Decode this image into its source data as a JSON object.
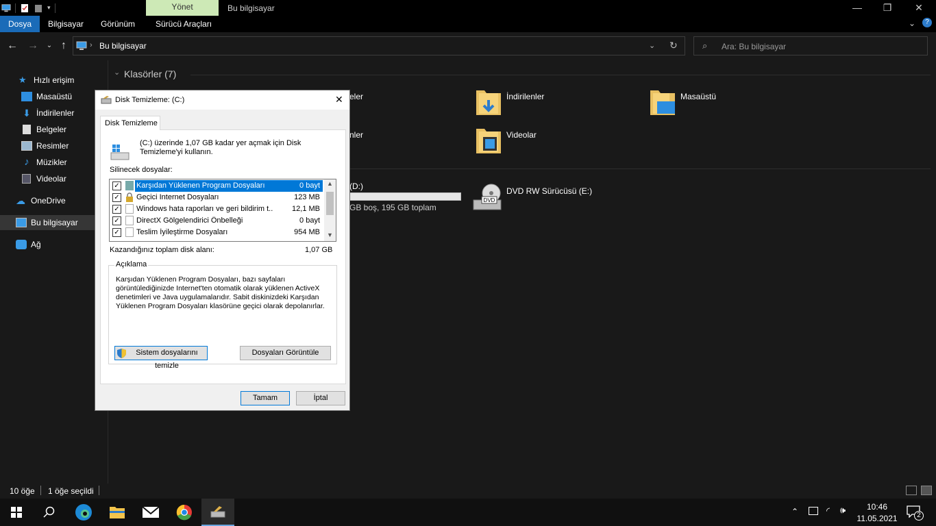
{
  "window": {
    "manage_tab": "Yönet",
    "title": "Bu bilgisayar",
    "minimize": "—",
    "restore": "❐",
    "close": "✕"
  },
  "ribbon": {
    "tabs": [
      "Dosya",
      "Bilgisayar",
      "Görünüm",
      "Sürücü Araçları"
    ]
  },
  "address": {
    "path": "Bu bilgisayar",
    "search_placeholder": "Ara: Bu bilgisayar"
  },
  "sidebar": {
    "items": [
      {
        "label": "Hızlı erişim"
      },
      {
        "label": "Masaüstü"
      },
      {
        "label": "İndirilenler"
      },
      {
        "label": "Belgeler"
      },
      {
        "label": "Resimler"
      },
      {
        "label": "Müzikler"
      },
      {
        "label": "Videolar"
      },
      {
        "label": "OneDrive"
      },
      {
        "label": "Bu bilgisayar"
      },
      {
        "label": "Ağ"
      }
    ]
  },
  "main": {
    "folders_header": "Klasörler (7)",
    "folders": [
      {
        "label": "eler"
      },
      {
        "label": "İndirilenler"
      },
      {
        "label": "Masaüstü"
      },
      {
        "label": "nler"
      },
      {
        "label": "Videolar"
      }
    ],
    "drives": [
      {
        "label": "(D:)",
        "free": "GB boş, 195 GB toplam"
      },
      {
        "label": "DVD RW Sürücüsü (E:)",
        "icon_text": "DVD"
      }
    ]
  },
  "status": {
    "item_count": "10 öğe",
    "selected": "1 öğe seçildi"
  },
  "taskbar": {
    "time": "10:46",
    "date": "11.05.2021",
    "notifications": "2"
  },
  "dialog": {
    "title": "Disk Temizleme:  (C:)",
    "tab": "Disk Temizleme",
    "intro_line1": "(C:) üzerinde 1,07 GB kadar yer açmak için Disk",
    "intro_line2": "Temizleme'yi kullanın.",
    "files_label": "Silinecek dosyalar:",
    "files": [
      {
        "name": "Karşıdan Yüklenen Program Dosyaları",
        "size": "0 bayt",
        "checked": true,
        "selected": true
      },
      {
        "name": "Geçici Internet Dosyaları",
        "size": "123 MB",
        "checked": true,
        "selected": false
      },
      {
        "name": "Windows hata raporları ve geri bildirim t...",
        "size": "12,1 MB",
        "checked": true,
        "selected": false
      },
      {
        "name": "DirectX Gölgelendirici Önbelleği",
        "size": "0 bayt",
        "checked": true,
        "selected": false
      },
      {
        "name": "Teslim İyileştirme Dosyaları",
        "size": "954 MB",
        "checked": true,
        "selected": false
      }
    ],
    "total_label": "Kazandığınız toplam disk alanı:",
    "total_value": "1,07 GB",
    "desc_legend": "Açıklama",
    "desc_line1": "Karşıdan Yüklenen Program Dosyaları, bazı sayfaları",
    "desc_line2": "görüntülediğinizde Internet'ten otomatik olarak yüklenen ActiveX",
    "desc_line3": "denetimleri ve Java uygulamalarıdır. Sabit diskinizdeki Karşıdan",
    "desc_line4": "Yüklenen Program Dosyaları klasörüne geçici olarak depolanırlar.",
    "clean_system": "Sistem dosyalarını temizle",
    "view_files": "Dosyaları Görüntüle",
    "ok": "Tamam",
    "cancel": "İptal",
    "close": "✕"
  }
}
